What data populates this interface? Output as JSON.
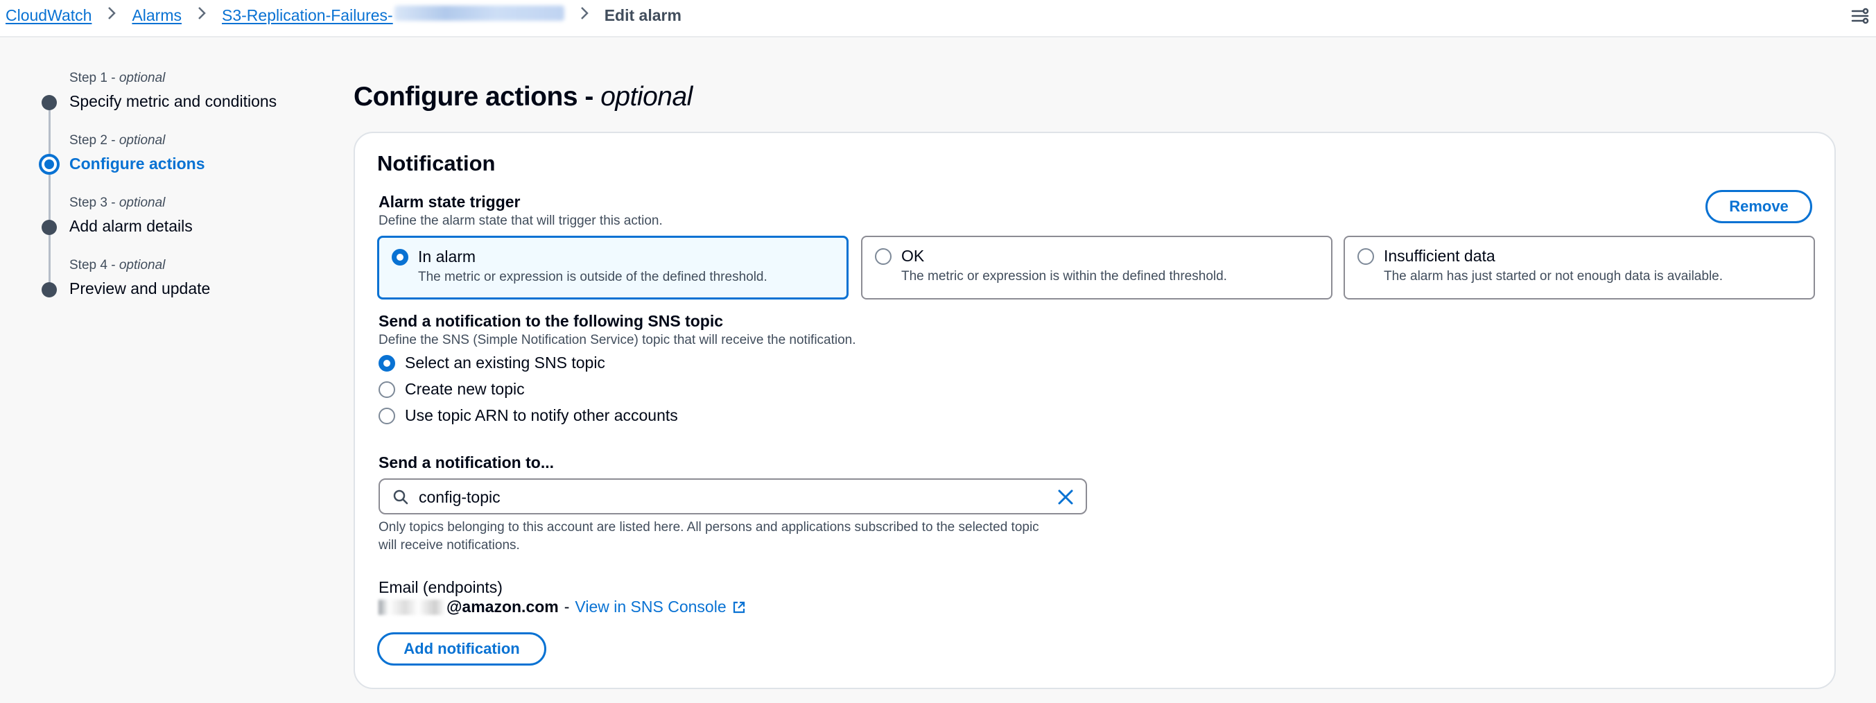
{
  "breadcrumb": {
    "items": [
      "CloudWatch",
      "Alarms",
      "S3-Replication-Failures-"
    ],
    "current": "Edit alarm"
  },
  "steps": [
    {
      "prefix": "Step 1 - ",
      "optional": "optional",
      "title": "Specify metric and conditions"
    },
    {
      "prefix": "Step 2 - ",
      "optional": "optional",
      "title": "Configure actions"
    },
    {
      "prefix": "Step 3 - ",
      "optional": "optional",
      "title": "Add alarm details"
    },
    {
      "prefix": "Step 4 - ",
      "optional": "optional",
      "title": "Preview and update"
    }
  ],
  "page": {
    "title": "Configure actions - ",
    "title_optional": "optional"
  },
  "notification": {
    "heading": "Notification",
    "remove_label": "Remove",
    "trigger_label": "Alarm state trigger",
    "trigger_desc": "Define the alarm state that will trigger this action.",
    "states": [
      {
        "title": "In alarm",
        "desc": "The metric or expression is outside of the defined threshold.",
        "selected": true
      },
      {
        "title": "OK",
        "desc": "The metric or expression is within the defined threshold.",
        "selected": false
      },
      {
        "title": "Insufficient data",
        "desc": "The alarm has just started or not enough data is available.",
        "selected": false
      }
    ],
    "sns_label": "Send a notification to the following SNS topic",
    "sns_desc": "Define the SNS (Simple Notification Service) topic that will receive the notification.",
    "sns_options": [
      "Select an existing SNS topic",
      "Create new topic",
      "Use topic ARN to notify other accounts"
    ],
    "sns_selected_index": 0,
    "send_to_label": "Send a notification to...",
    "search_value": "config-topic",
    "help_line1": "Only topics belonging to this account are listed here. All persons and applications subscribed to the selected topic",
    "help_line2": "will receive notifications.",
    "email_label": "Email (endpoints)",
    "email_address": "@amazon.com",
    "email_dash": "-",
    "sns_console_link": "View in SNS Console",
    "add_notification_label": "Add notification"
  },
  "colors": {
    "accent": "#0972d3",
    "text": "#000716",
    "muted": "#414d5c",
    "border": "#8c8c94"
  },
  "icons": [
    "chevron-right-icon",
    "layout-toggle-icon",
    "search-icon",
    "close-icon",
    "external-link-icon"
  ]
}
